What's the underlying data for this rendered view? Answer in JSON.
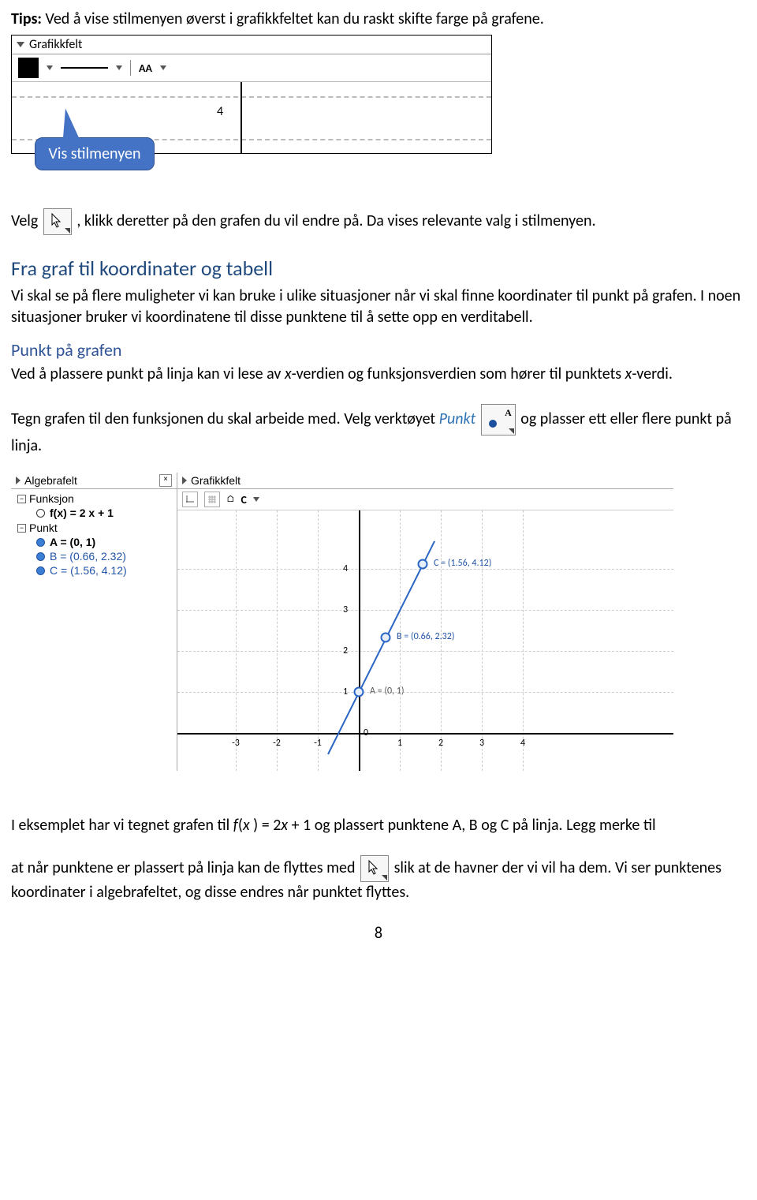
{
  "tips": {
    "label": "Tips:",
    "text": "Ved å vise stilmenyen øverst i grafikkfeltet kan du raskt skifte farge på grafene."
  },
  "fig1": {
    "header": "Grafikkfelt",
    "aa": "AA",
    "axis4": "4",
    "callout": "Vis stilmenyen"
  },
  "line2": {
    "pre": "Velg ",
    "mid": ", klikk deretter på den grafen du vil endre på. Da vises relevante valg i stilmenyen."
  },
  "section1": {
    "title": "Fra graf til koordinater og tabell",
    "body": "Vi skal se på flere muligheter vi kan bruke i ulike situasjoner når vi skal finne koordinater til punkt på grafen. I noen situasjoner bruker vi koordinatene til disse punktene til å sette opp en verditabell."
  },
  "section2": {
    "title": "Punkt på grafen",
    "body_pre": "Ved å plassere punkt på linja kan vi lese av ",
    "body_x1": "x",
    "body_mid1": "-verdien og funksjonsverdien som hører til punktets ",
    "body_x2": "x",
    "body_mid2": "-verdi."
  },
  "line3": {
    "pre": "Tegn grafen til den funksjonen du skal arbeide med. Velg verktøyet ",
    "tool": "Punkt",
    "iconA": "A",
    "post": " og plasser ett eller flere punkt på linja."
  },
  "fig2": {
    "alg_header": "Algebrafelt",
    "graf_header": "Grafikkfelt",
    "close": "×",
    "tree": {
      "box_minus": "−",
      "funksjon": "Funksjon",
      "fx_label": "f(x) = 2 x + 1",
      "punkt": "Punkt",
      "A": "A = (0, 1)",
      "B": "B = (0.66, 2.32)",
      "C": "C = (1.56, 4.12)"
    },
    "toolbar_home": "⌂",
    "toolbar_C": "C",
    "ticks_x": [
      "-3",
      "-2",
      "-1",
      "1",
      "2",
      "3",
      "4"
    ],
    "ticks_y": [
      "0",
      "1",
      "2",
      "3",
      "4"
    ],
    "pointA_lbl": "A = (0, 1)",
    "pointB_lbl": "B = (0.66, 2.32)",
    "pointC_lbl": "C = (1.56, 4.12)"
  },
  "para_eks": {
    "pre": "I eksemplet har vi tegnet grafen til ",
    "fx": "f",
    "par_open": "(",
    "x": "x",
    "par_close": " )",
    "eq": " = 2",
    "x2": "x",
    "plus": " + 1 og plassert punktene A, B og C på linja. Legg merke til"
  },
  "para_last": {
    "pre": "at når punktene er plassert på linja kan de flyttes med ",
    "post": " slik at de havner der vi vil ha dem. Vi ser punktenes koordinater i algebrafeltet, og disse endres når punktet flyttes."
  },
  "pagenum": "8",
  "chart_data": {
    "fig1_axis": {
      "y_tick_shown": 4
    },
    "fig2": {
      "type": "line",
      "function": "f(x) = 2x + 1",
      "x_range": [
        -3.5,
        4.5
      ],
      "y_range": [
        -0.5,
        4.7
      ],
      "x_ticks": [
        -3,
        -2,
        -1,
        0,
        1,
        2,
        3,
        4
      ],
      "y_ticks": [
        0,
        1,
        2,
        3,
        4
      ],
      "points": [
        {
          "name": "A",
          "x": 0,
          "y": 1
        },
        {
          "name": "B",
          "x": 0.66,
          "y": 2.32
        },
        {
          "name": "C",
          "x": 1.56,
          "y": 4.12
        }
      ]
    }
  }
}
